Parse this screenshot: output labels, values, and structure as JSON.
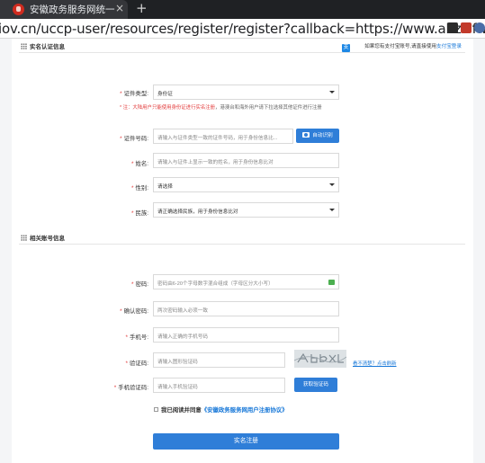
{
  "browser": {
    "tab_title": "安徽政务服务网统一",
    "tab_close": "×",
    "new_tab": "+",
    "url": "iov.cn/uccp-user/resources/register/register?callback=https://www.ahzwfw.gov.cn&appC"
  },
  "section_realname": {
    "title": "实名认证信息",
    "alipay_hint": "如果您有支付宝账号,请直接使用",
    "alipay_link": "支付宝登录",
    "alipay_logo": "支"
  },
  "form": {
    "id_type": {
      "label": "证件类型:",
      "value": "身份证"
    },
    "id_note_red": "* 注：大陆用户只能使用身份证进行实名注册",
    "id_note_rest": "，港澳台和海外用户请下拉选择其他证件进行注册",
    "id_number": {
      "label": "证件号码:",
      "placeholder": "请输入与证件类型一致的证件号码，用于身份信息比...",
      "ocr_button": "自动识别"
    },
    "name": {
      "label": "姓名:",
      "placeholder": "请输入与证件上显示一致的姓名，用于身份信息比对"
    },
    "gender": {
      "label": "性别:",
      "value": "请选择"
    },
    "ethnicity": {
      "label": "民族:",
      "value": "请正确选择民族，用于身份信息比对"
    }
  },
  "section_account": {
    "title": "相关账号信息",
    "password": {
      "label": "密码:",
      "placeholder": "密码由6-20个字母数字混合组成（字母区分大小写）"
    },
    "confirm_password": {
      "label": "确认密码:",
      "placeholder": "两次密码输入必须一致"
    },
    "phone": {
      "label": "手机号:",
      "placeholder": "请输入正确的手机号码"
    },
    "captcha": {
      "label": "验证码:",
      "placeholder": "请输入图形验证码",
      "refresh_text": "看不清楚？点击刷新"
    },
    "sms_code": {
      "label": "手机验证码:",
      "placeholder": "请输入手机验证码",
      "get_button": "获取验证码"
    },
    "agree_prefix": "我已阅读并同意",
    "agree_link": "《安徽政务服务网用户注册协议》",
    "submit": "实名注册"
  },
  "colors": {
    "primary": "#2f7ed8",
    "required": "#e23b3b",
    "link": "#1677d8"
  }
}
